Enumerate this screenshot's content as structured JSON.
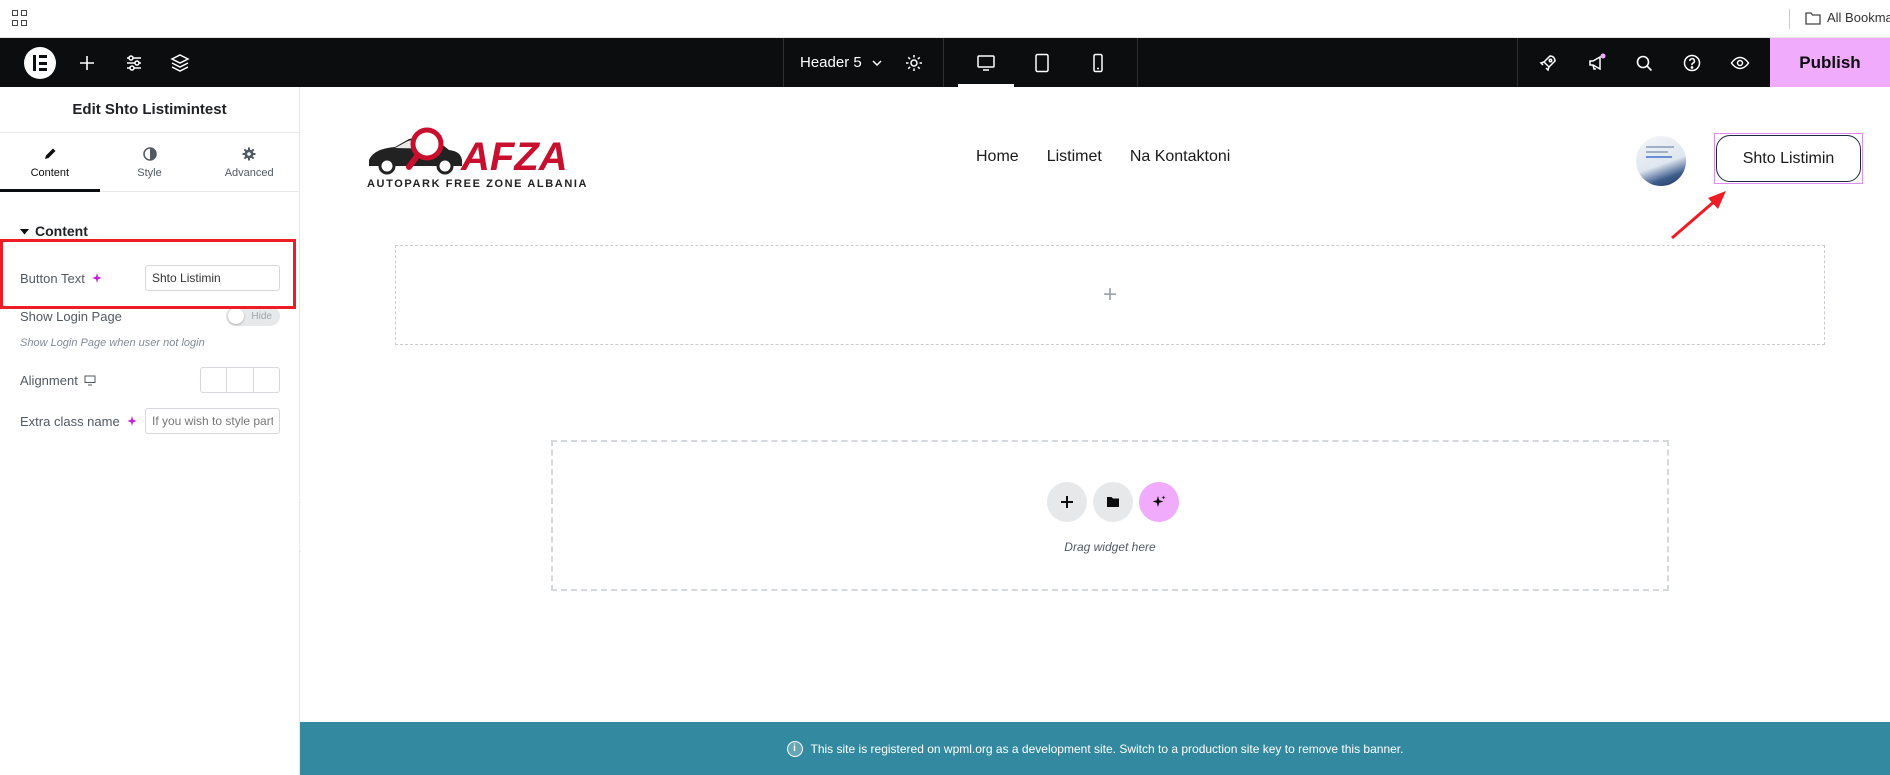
{
  "browser": {
    "bookmarks_label": "All Bookma"
  },
  "topbar": {
    "document_title": "Header 5",
    "publish_label": "Publish",
    "accent_color": "#f0abfc"
  },
  "panel": {
    "title": "Edit Shto Listimintest",
    "tabs": [
      {
        "label": "Content",
        "icon": "pencil-icon",
        "active": true
      },
      {
        "label": "Style",
        "icon": "half-circle-icon",
        "active": false
      },
      {
        "label": "Advanced",
        "icon": "gear-icon",
        "active": false
      }
    ],
    "section_title": "Content",
    "controls": {
      "button_text_label": "Button Text",
      "button_text_value": "Shto Listimin",
      "show_login_label": "Show Login Page",
      "toggle_label": "Hide",
      "show_login_description": "Show Login Page when user not login",
      "alignment_label": "Alignment",
      "extra_class_label": "Extra class name",
      "extra_class_placeholder": "If you wish to style part"
    }
  },
  "canvas": {
    "site_logo_text": "AFZA",
    "site_logo_tagline": "AUTOPARK FREE ZONE ALBANIA",
    "nav": [
      "Home",
      "Listimet",
      "Na Kontaktoni"
    ],
    "cta_label": "Shto Listimin",
    "drop_area_hint": "Drag widget here"
  },
  "banner": {
    "text": "This site is registered on wpml.org as a development site. Switch to a production site key to remove this banner."
  }
}
